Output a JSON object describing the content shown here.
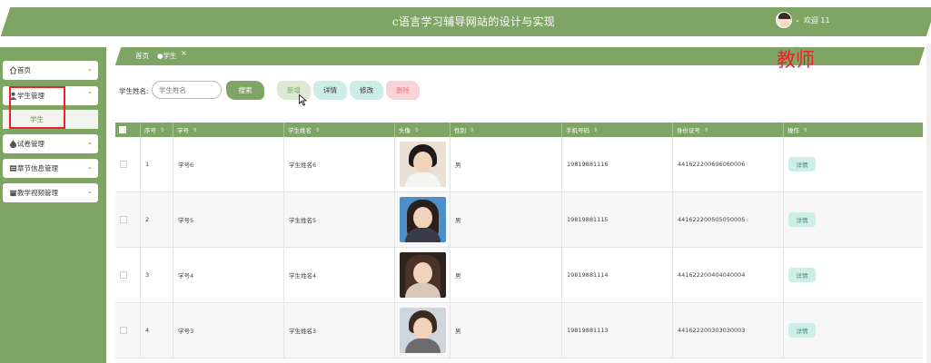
{
  "header": {
    "title": "c语言学习辅导网站的设计与实现",
    "welcome": "欢迎 11"
  },
  "sidebar": {
    "items": [
      {
        "label": "首页",
        "icon": "home-icon",
        "caret": "⌄"
      },
      {
        "label": "学生管理",
        "icon": "user-icon",
        "caret": "⌃",
        "expanded": true,
        "children": [
          "学生"
        ]
      },
      {
        "label": "试卷管理",
        "icon": "drop-icon",
        "caret": "⌄"
      },
      {
        "label": "章节信息管理",
        "icon": "card-icon",
        "caret": "⌄"
      },
      {
        "label": "教学视频管理",
        "icon": "box-icon",
        "caret": "⌄"
      }
    ]
  },
  "breadcrumb": {
    "home": "首页",
    "current": "●学生",
    "close": "×"
  },
  "annotation": "教师",
  "search": {
    "label": "学生姓名:",
    "placeholder": "学生姓名",
    "button": "搜索"
  },
  "actions": {
    "add": "新增",
    "detail": "详情",
    "edit": "修改",
    "delete": "删除"
  },
  "table": {
    "columns": [
      "序号",
      "学号",
      "学生姓名",
      "头像",
      "性别",
      "手机号码",
      "身份证号",
      "操作"
    ],
    "sort_glyph": "⇕",
    "rows": [
      {
        "no": "1",
        "id": "学号6",
        "name": "学生姓名6",
        "avatar": "male-portrait-1",
        "gender": "男",
        "phone": "19819881116",
        "idcard": "441622200606060006",
        "op": "详情"
      },
      {
        "no": "2",
        "id": "学号5",
        "name": "学生姓名5",
        "avatar": "female-portrait-1",
        "gender": "男",
        "phone": "19819881115",
        "idcard": "441622200505050005",
        "op": "详情"
      },
      {
        "no": "3",
        "id": "学号4",
        "name": "学生姓名4",
        "avatar": "female-portrait-2",
        "gender": "男",
        "phone": "19819881114",
        "idcard": "441622200404040004",
        "op": "详情"
      },
      {
        "no": "4",
        "id": "学号3",
        "name": "学生姓名3",
        "avatar": "male-portrait-2",
        "gender": "男",
        "phone": "19819881113",
        "idcard": "441622200303030003",
        "op": "详情"
      }
    ]
  },
  "colors": {
    "primary": "#7ea563",
    "highlight": "#e8242b",
    "detail_bg": "#cdeee6",
    "delete_bg": "#f8d4d8"
  }
}
